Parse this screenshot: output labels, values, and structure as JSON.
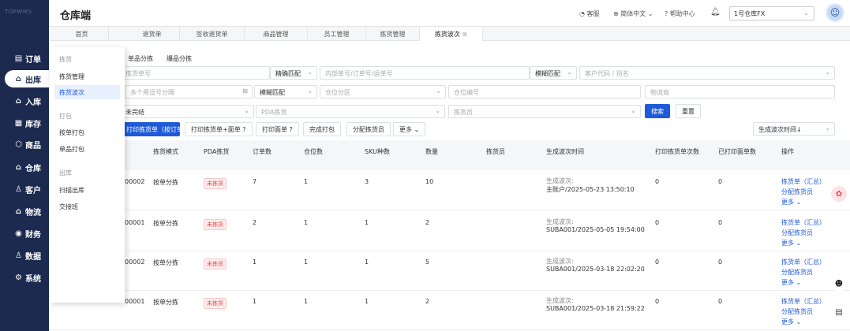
{
  "brand": {
    "logo": "TOPWMS"
  },
  "nav": [
    {
      "label": "订单",
      "icon": "order-icon",
      "glyph": "▤"
    },
    {
      "label": "出库",
      "icon": "outbound-icon",
      "glyph": "⌂"
    },
    {
      "label": "入库",
      "icon": "inbound-icon",
      "glyph": "⌂"
    },
    {
      "label": "库存",
      "icon": "stock-icon",
      "glyph": "▦"
    },
    {
      "label": "商品",
      "icon": "goods-icon",
      "glyph": "⬡"
    },
    {
      "label": "仓库",
      "icon": "warehouse-icon",
      "glyph": "⌂"
    },
    {
      "label": "客户",
      "icon": "customer-icon",
      "glyph": "♙"
    },
    {
      "label": "物流",
      "icon": "logistics-icon",
      "glyph": "⌂"
    },
    {
      "label": "财务",
      "icon": "finance-icon",
      "glyph": "◉"
    },
    {
      "label": "数据",
      "icon": "data-icon",
      "glyph": "♙"
    },
    {
      "label": "系统",
      "icon": "system-icon",
      "glyph": "⚙"
    }
  ],
  "header": {
    "title": "仓库端",
    "service": "客服",
    "language": "简体中文",
    "help": "帮助中心",
    "warehouse": "1号仓库FX"
  },
  "tabs": [
    "首页",
    "退货单",
    "签收退货单",
    "商品管理",
    "员工管理",
    "拣货管理",
    "拣货波次"
  ],
  "subtabs": [
    "单品分拣",
    "爆品分拣"
  ],
  "popup": {
    "group1": "拣货",
    "items1": [
      "拣货管理",
      "拣货波次"
    ],
    "group2": "打包",
    "items2": [
      "按单打包",
      "单品打包"
    ],
    "group3": "出库",
    "items3": [
      "扫描出库",
      "交接班"
    ]
  },
  "filters": {
    "wave_no": "拣货单号",
    "match1": "精确匹配",
    "order_no": "内部单号/订单号/运单号",
    "match2": "模糊匹配",
    "customer": "客户代码 / 别名",
    "multi_sep": "多个用逗号分隔",
    "match3": "模糊匹配",
    "zone": "仓位分区",
    "loc_no": "仓位编号",
    "carrier": "物流商",
    "status": "未完结",
    "pda": "PDA拣货",
    "picker": "拣货员",
    "search": "搜索",
    "reset": "重置"
  },
  "actions": {
    "print_pick": "打印拣货单（按订单）",
    "print_pick_face": "打印拣货单+面单",
    "print_face": "打印面单",
    "finish_pack": "完成打包",
    "assign_picker": "分配拣货员",
    "more": "更多",
    "sort": "生成波次时间↓"
  },
  "columns": [
    "拣货模式",
    "PDA拣货",
    "订单数",
    "仓位数",
    "SKU种数",
    "数量",
    "拣货员",
    "生成波次时间",
    "打印拣货单次数",
    "已打印面单数",
    "操作"
  ],
  "rows": [
    {
      "id": "00002",
      "mode": "按单分拣",
      "pda": "未拣货",
      "orders": "7",
      "locs": "1",
      "skus": "3",
      "qty": "10",
      "picker": "",
      "time_label": "生成波次:",
      "time": "主账户/2025-05-23 13:50:10",
      "prints": "0",
      "faces": "0"
    },
    {
      "id": "00001",
      "mode": "按单分拣",
      "pda": "未拣货",
      "orders": "2",
      "locs": "1",
      "skus": "1",
      "qty": "2",
      "picker": "",
      "time_label": "生成波次:",
      "time": "SUBA001/2025-05-05 19:54:00",
      "prints": "0",
      "faces": "0"
    },
    {
      "id": "00002",
      "mode": "按单分拣",
      "pda": "未拣货",
      "orders": "1",
      "locs": "1",
      "skus": "1",
      "qty": "5",
      "picker": "",
      "time_label": "生成波次:",
      "time": "SUBA001/2025-03-18 22:02:20",
      "prints": "0",
      "faces": "0"
    },
    {
      "id": "00001",
      "mode": "按单分拣",
      "pda": "未拣货",
      "orders": "1",
      "locs": "1",
      "skus": "1",
      "qty": "2",
      "picker": "",
      "time_label": "生成波次:",
      "time": "SUBA001/2025-03-18 21:59:22",
      "prints": "0",
      "faces": "0"
    }
  ],
  "row_ops": {
    "op1": "拣货单（汇总）",
    "op2": "分配拣货员",
    "op3": "更多"
  }
}
